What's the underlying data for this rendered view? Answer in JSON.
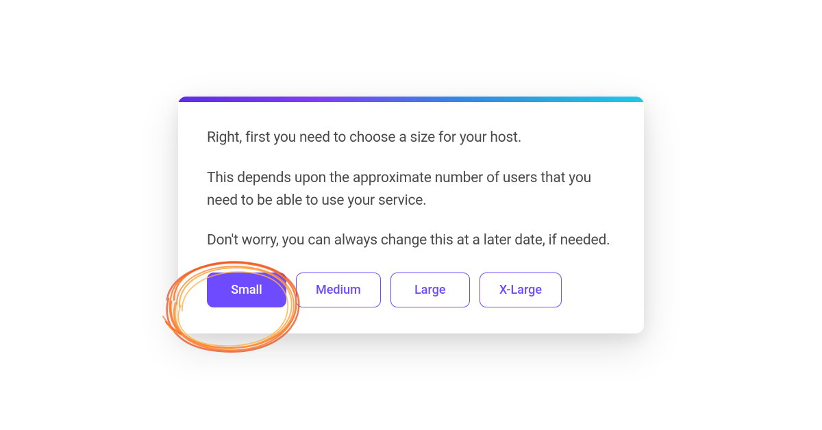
{
  "card": {
    "paragraphs": [
      "Right, first you need to choose a size for your host.",
      "This depends upon the approximate number of users that you need to be able to use your service.",
      "Don't worry, you can always change this at a later date, if needed."
    ],
    "sizes": [
      {
        "label": "Small",
        "selected": true
      },
      {
        "label": "Medium",
        "selected": false
      },
      {
        "label": "Large",
        "selected": false
      },
      {
        "label": "X-Large",
        "selected": false
      }
    ]
  },
  "colors": {
    "accent": "#6F4BFF",
    "gradientStart": "#5B2EE5",
    "gradientEnd": "#1FC8E3",
    "highlightStroke": "#FF7A2E"
  }
}
